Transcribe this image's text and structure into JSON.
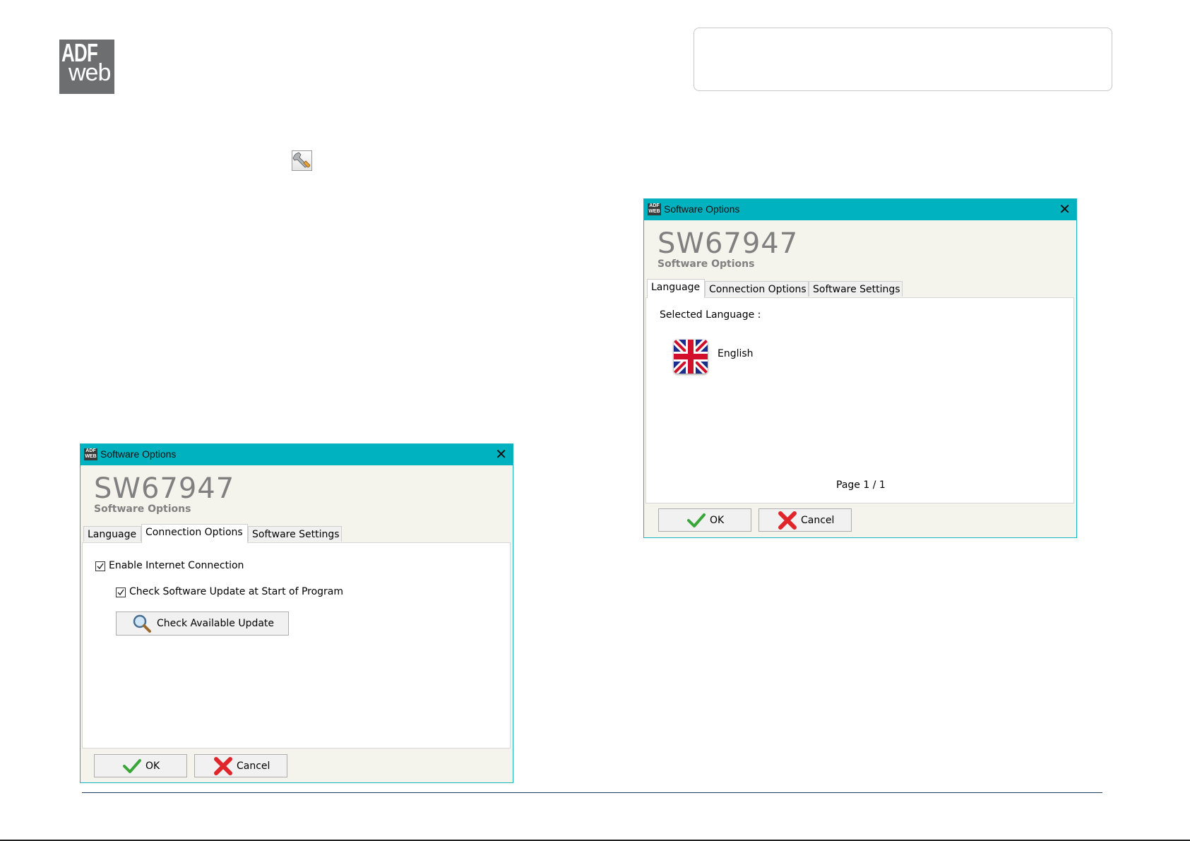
{
  "logo": {
    "line1": "ADF",
    "line2": "web"
  },
  "icons": {
    "tools": "wrench-screwdriver-icon",
    "flag": "union-jack-flag-icon",
    "search": "magnifier-icon",
    "ok": "green-check-icon",
    "cancel": "red-x-icon"
  },
  "colors": {
    "titlebar": "#00b2bf",
    "footer_line": "#1f3b64"
  },
  "dialog_language": {
    "app_icon_text": "ADF WEB",
    "title": "Software Options",
    "close": "✕",
    "heading": "SW67947",
    "subheading": "Software Options",
    "tabs": [
      "Language",
      "Connection Options",
      "Software Settings"
    ],
    "active_tab": "Language",
    "selected_language_label": "Selected Language :",
    "language": "English",
    "page_indicator": "Page 1 / 1",
    "ok_label": "OK",
    "cancel_label": "Cancel"
  },
  "dialog_connection": {
    "app_icon_text": "ADF WEB",
    "title": "Software Options",
    "close": "✕",
    "heading": "SW67947",
    "subheading": "Software Options",
    "tabs": [
      "Language",
      "Connection Options",
      "Software Settings"
    ],
    "active_tab": "Connection Options",
    "enable_internet_label": "Enable Internet Connection",
    "enable_internet_checked": true,
    "check_update_label": "Check Software Update at Start of Program",
    "check_update_checked": true,
    "check_available_button": "Check Available Update",
    "ok_label": "OK",
    "cancel_label": "Cancel"
  }
}
